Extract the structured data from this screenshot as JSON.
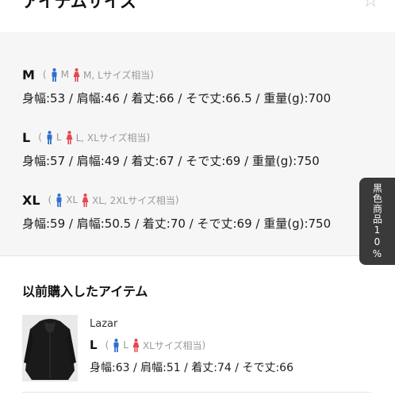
{
  "header": {
    "title": "アイテムサイズ",
    "close_icon": "close-icon"
  },
  "sizes": [
    {
      "label": "M",
      "men_size": "M",
      "women_size": "M, Lサイズ相当",
      "measurements": "身幅:53 / 肩幅:46 / 着丈:66 / そで丈:66.5 / 重量(g):700"
    },
    {
      "label": "L",
      "men_size": "L",
      "women_size": "L, XLサイズ相当",
      "measurements": "身幅:57 / 肩幅:49 / 着丈:67 / そで丈:69 / 重量(g):750"
    },
    {
      "label": "XL",
      "men_size": "XL",
      "women_size": "XL, 2XLサイズ相当",
      "measurements": "身幅:59 / 肩幅:50.5 / 着丈:70 / そで丈:69 / 重量(g):750"
    }
  ],
  "past_purchase": {
    "title": "以前購入したアイテム",
    "item_name": "Lazar",
    "size_label": "L",
    "men_size": "L",
    "women_size": "XLサイズ相当",
    "measurements": "身幅:63 / 肩幅:51 / 着丈:74 / そで丈:66"
  },
  "side_tab": {
    "label": "黒色商品10%"
  },
  "colors": {
    "men_icon": "#2f6fcf",
    "women_icon": "#e5484d",
    "section_bg": "#f6f6f6",
    "side_tab_bg": "#3a3a3a"
  }
}
